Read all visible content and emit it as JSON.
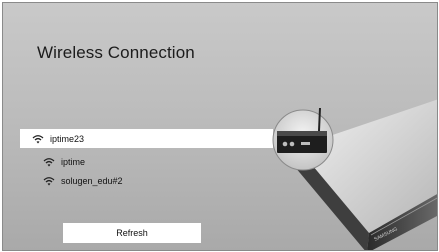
{
  "screen": {
    "title": "Wireless Connection"
  },
  "networks": [
    {
      "ssid": "iptime23",
      "selected": true,
      "icon": "wifi-signal-icon"
    },
    {
      "ssid": "iptime",
      "selected": false,
      "icon": "wifi-signal-icon"
    },
    {
      "ssid": "solugen_edu#2",
      "selected": false,
      "icon": "wifi-signal-icon"
    }
  ],
  "actions": {
    "refresh_label": "Refresh"
  },
  "device": {
    "brand": "SAMSUNG"
  },
  "colors": {
    "background_top": "#c9c9c9",
    "background_bottom": "#a9a9a9",
    "highlight": "#ffffff",
    "text": "#111111"
  }
}
